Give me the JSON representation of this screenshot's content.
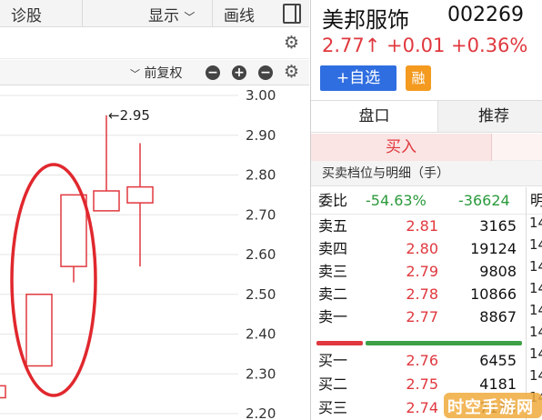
{
  "left_toolbar": {
    "tab_diagnose": "诊股",
    "display_label": "显示",
    "display_chevron": "﹀",
    "draw_label": "画线"
  },
  "chart_toolbar": {
    "adjust_label": "前复权",
    "adjust_chevron": "﹀"
  },
  "chart_data": {
    "type": "candlestick",
    "y_ticks": [
      "3.00",
      "2.90",
      "2.80",
      "2.70",
      "2.60",
      "2.50",
      "2.40",
      "2.30",
      "2.20"
    ],
    "ylim": [
      2.2,
      3.0
    ],
    "high_annotation": "←2.95",
    "candles": [
      {
        "open": 2.27,
        "close": 2.24,
        "high": 2.27,
        "low": 2.24,
        "color": "red"
      },
      {
        "open": 2.32,
        "close": 2.5,
        "high": 2.5,
        "low": 2.32,
        "color": "red"
      },
      {
        "open": 2.57,
        "close": 2.75,
        "high": 2.75,
        "low": 2.53,
        "color": "red"
      },
      {
        "open": 2.71,
        "close": 2.76,
        "high": 2.95,
        "low": 2.71,
        "color": "red"
      },
      {
        "open": 2.73,
        "close": 2.77,
        "high": 2.88,
        "low": 2.57,
        "color": "red"
      }
    ],
    "annotation_shape": "ellipse",
    "colors": {
      "up": "#e0383e",
      "grid": "#e6e6e6",
      "text": "#333333"
    }
  },
  "quote": {
    "name": "美邦服饰",
    "code": "002269",
    "price_line": "2.77↑ +0.01 +0.36%",
    "watch_button": "+自选",
    "rong_badge": "融"
  },
  "tabs": {
    "pankou": "盘口",
    "tuijian": "推荐",
    "buy": "买入"
  },
  "detail_header": "买卖档位与明细（手）",
  "weibi": {
    "label": "委比",
    "ratio": "-54.63%",
    "diff": "-36624",
    "side_char": "明"
  },
  "sell_levels": [
    {
      "label": "卖五",
      "price": "2.81",
      "volume": "3165"
    },
    {
      "label": "卖四",
      "price": "2.80",
      "volume": "19124"
    },
    {
      "label": "卖三",
      "price": "2.79",
      "volume": "9808"
    },
    {
      "label": "卖二",
      "price": "2.78",
      "volume": "10866"
    },
    {
      "label": "卖一",
      "price": "2.77",
      "volume": "8867"
    }
  ],
  "buy_levels": [
    {
      "label": "买一",
      "price": "2.76",
      "volume": "6455"
    },
    {
      "label": "买二",
      "price": "2.75",
      "volume": "4181"
    },
    {
      "label": "买三",
      "price": "2.74",
      "volume": "7135"
    }
  ],
  "time_column": [
    "14",
    "14",
    "14",
    "14",
    "14",
    "14",
    "14",
    "14",
    "14"
  ],
  "order_ratio": {
    "buy_fraction": 0.2273,
    "sell_fraction": 0.7727
  },
  "watermark": {
    "text": "时空手游网"
  },
  "colors": {
    "red": "#e0383e",
    "green": "#2b9a3c",
    "blue": "#2f6ee0",
    "orange": "#f39a1f"
  }
}
